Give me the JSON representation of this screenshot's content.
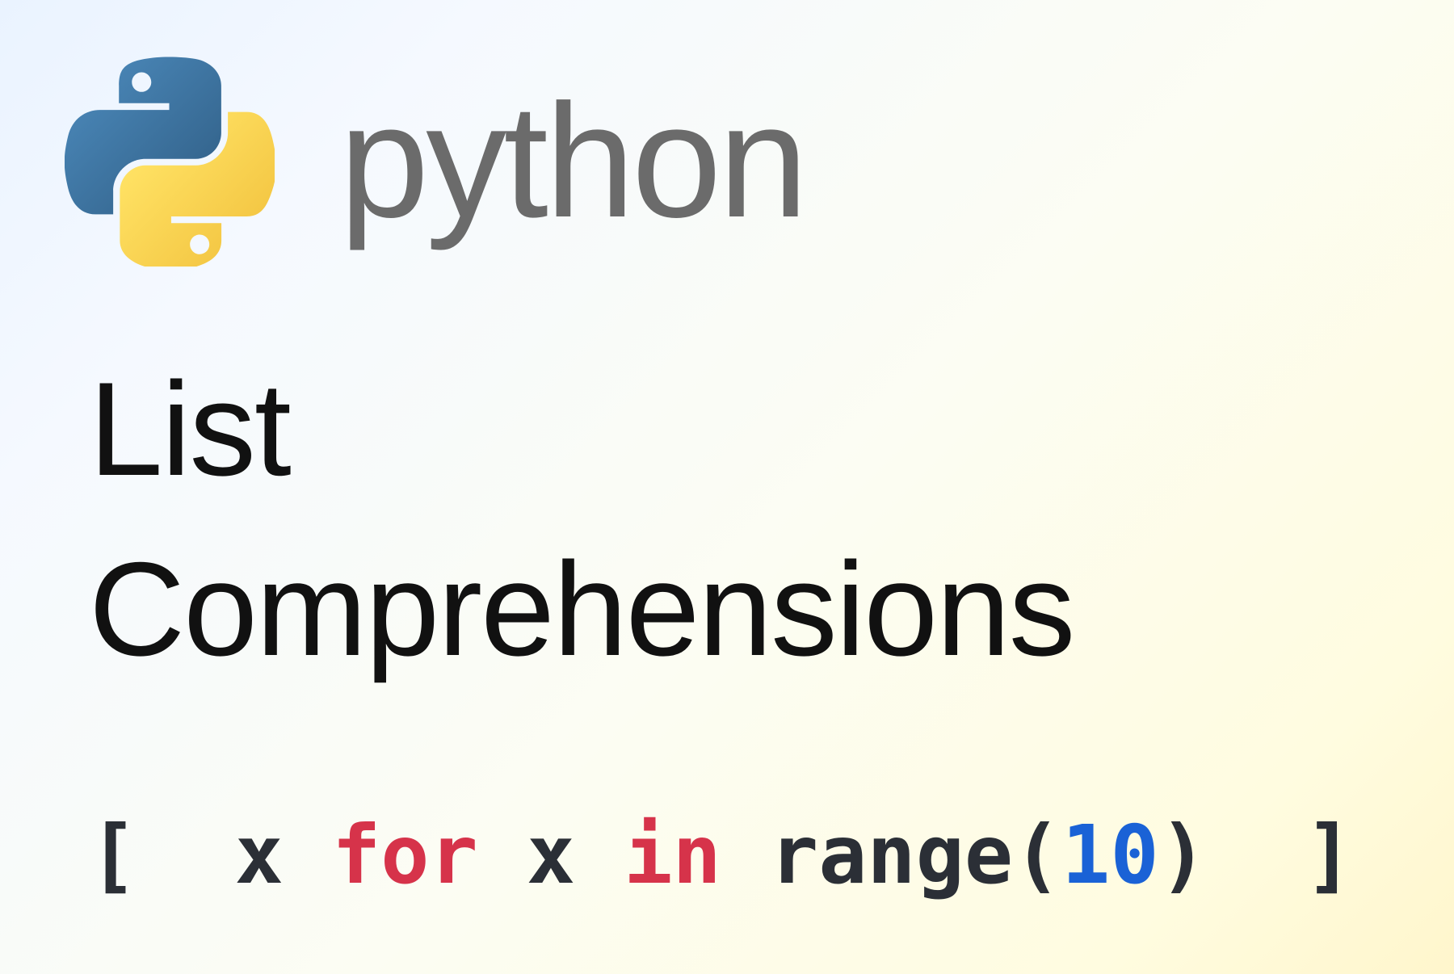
{
  "header": {
    "wordmark": "python",
    "logo_name": "python-logo-icon",
    "logo_colors": {
      "blue": "#3d6e9e",
      "yellow": "#f7cf3c"
    }
  },
  "title": {
    "line1": "List",
    "line2": "Comprehensions"
  },
  "code": {
    "tokens": [
      {
        "t": "[",
        "cls": "tok-bracket"
      },
      {
        "t": "  ",
        "cls": "tok-var"
      },
      {
        "t": "x",
        "cls": "tok-var"
      },
      {
        "t": " ",
        "cls": "tok-var"
      },
      {
        "t": "for",
        "cls": "tok-kw"
      },
      {
        "t": " ",
        "cls": "tok-var"
      },
      {
        "t": "x",
        "cls": "tok-var"
      },
      {
        "t": " ",
        "cls": "tok-var"
      },
      {
        "t": "in",
        "cls": "tok-kw"
      },
      {
        "t": " ",
        "cls": "tok-var"
      },
      {
        "t": "range",
        "cls": "tok-func"
      },
      {
        "t": "(",
        "cls": "tok-paren"
      },
      {
        "t": "10",
        "cls": "tok-num"
      },
      {
        "t": ")",
        "cls": "tok-paren"
      },
      {
        "t": "  ",
        "cls": "tok-var"
      },
      {
        "t": "]",
        "cls": "tok-bracket"
      }
    ],
    "colors": {
      "default": "#2b2f36",
      "keyword": "#d6334a",
      "number": "#1a62d6"
    }
  }
}
